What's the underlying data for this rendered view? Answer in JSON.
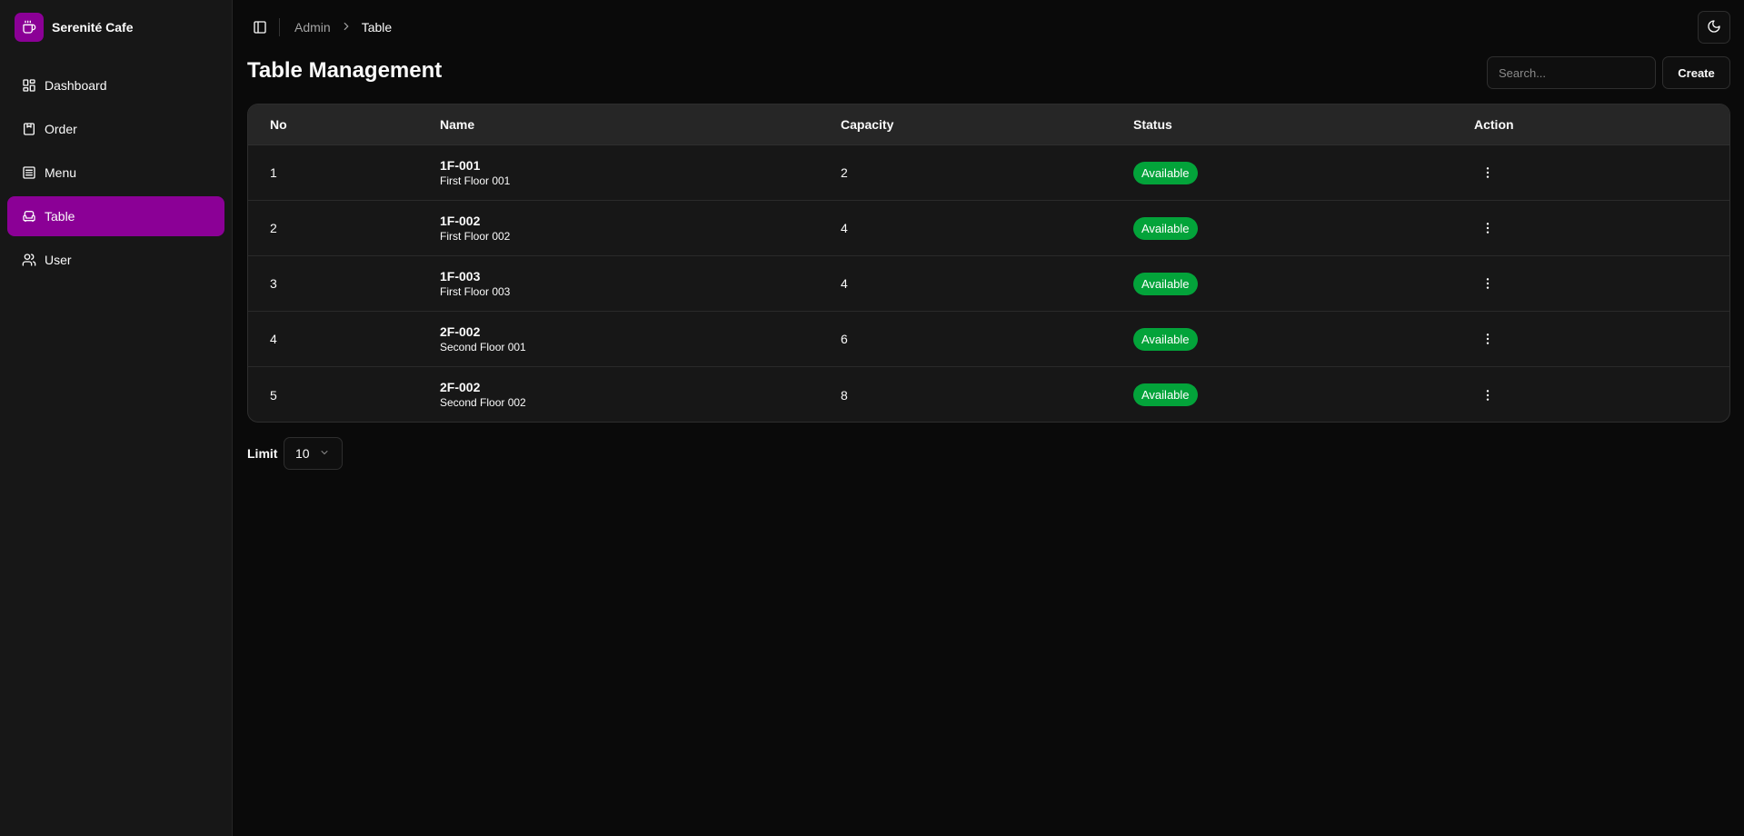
{
  "brand": {
    "name": "Serenité Cafe",
    "icon": "coffee-icon",
    "color": "#8b0096"
  },
  "sidebar": {
    "items": [
      {
        "label": "Dashboard",
        "icon": "dashboard-icon",
        "active": false
      },
      {
        "label": "Order",
        "icon": "order-icon",
        "active": false
      },
      {
        "label": "Menu",
        "icon": "menu-list-icon",
        "active": false
      },
      {
        "label": "Table",
        "icon": "table-sofa-icon",
        "active": true
      },
      {
        "label": "User",
        "icon": "users-icon",
        "active": false
      }
    ]
  },
  "breadcrumb": {
    "parent": "Admin",
    "current": "Table"
  },
  "page": {
    "title": "Table Management",
    "search_placeholder": "Search...",
    "create_label": "Create"
  },
  "table": {
    "headers": {
      "no": "No",
      "name": "Name",
      "capacity": "Capacity",
      "status": "Status",
      "action": "Action"
    },
    "rows": [
      {
        "no": "1",
        "code": "1F-001",
        "desc": "First Floor 001",
        "capacity": "2",
        "status": "Available"
      },
      {
        "no": "2",
        "code": "1F-002",
        "desc": "First Floor 002",
        "capacity": "4",
        "status": "Available"
      },
      {
        "no": "3",
        "code": "1F-003",
        "desc": "First Floor 003",
        "capacity": "4",
        "status": "Available"
      },
      {
        "no": "4",
        "code": "2F-002",
        "desc": "Second Floor 001",
        "capacity": "6",
        "status": "Available"
      },
      {
        "no": "5",
        "code": "2F-002",
        "desc": "Second Floor 002",
        "capacity": "8",
        "status": "Available"
      }
    ]
  },
  "pagination": {
    "limit_label": "Limit",
    "limit_value": "10"
  },
  "colors": {
    "accent": "#8b0096",
    "status_available": "#03a33a",
    "background": "#0a0a0a",
    "sidebar": "#171717"
  }
}
